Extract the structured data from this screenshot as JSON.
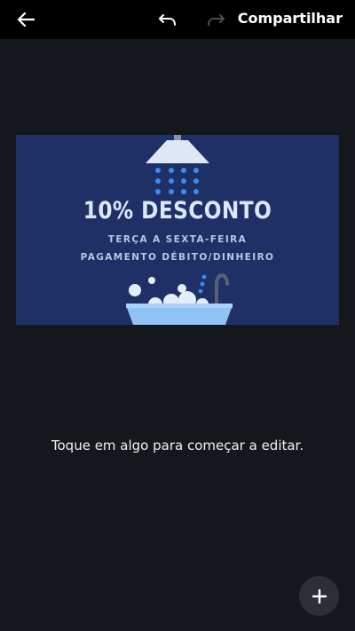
{
  "toolbar": {
    "share_label": "Compartilhar",
    "back_icon": "arrow-left-icon",
    "undo_icon": "undo-icon",
    "redo_icon": "redo-icon"
  },
  "design": {
    "headline": "10% DESCONTO",
    "line1": "TERÇA A SEXTA-FEIRA",
    "line2": "PAGAMENTO DÉBITO/DINHEIRO",
    "background_color": "#1e3066",
    "accent_color": "#3b8cf0"
  },
  "hint": "Toque em algo para começar a editar.",
  "fab": {
    "icon": "plus-icon"
  }
}
